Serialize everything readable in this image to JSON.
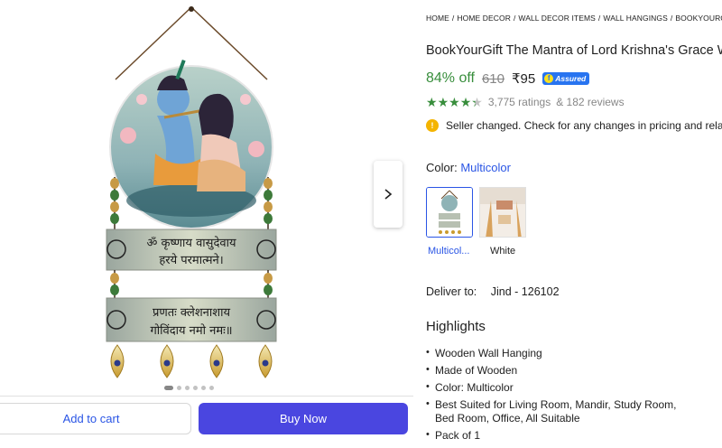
{
  "breadcrumb": [
    "HOME",
    "HOME DECOR",
    "WALL DECOR ITEMS",
    "WALL HANGINGS",
    "BOOKYOURGIF"
  ],
  "product": {
    "title": "BookYourGift The Mantra of Lord Krishna's Grace W",
    "discount": "84% off",
    "mrp": "610",
    "price": "₹95",
    "assured_label": "Assured",
    "rating_stars": 4.3,
    "ratings_text": "3,775 ratings",
    "reviews_text": "& 182 reviews"
  },
  "seller_notice": "Seller changed. Check for any changes in pricing and relate",
  "color": {
    "label": "Color:",
    "selected": "Multicolor",
    "options": [
      "Multicol...",
      "White"
    ]
  },
  "delivery": {
    "label": "Deliver to:",
    "location": "Jind - 126102"
  },
  "highlights": {
    "title": "Highlights",
    "items": [
      "Wooden Wall Hanging",
      "Made of Wooden",
      "Color: Multicolor",
      "Best Suited for Living Room, Mandir, Study Room, Bed Room, Office, All Suitable",
      "Pack of 1"
    ]
  },
  "artwork": {
    "line1": "ॐ कृष्णाय वासुदेवाय",
    "line2": "हरये परमात्मने।",
    "line3": "प्रणतः क्लेशनाशाय",
    "line4": "गोविंदाय नमो नमः॥"
  },
  "gallery": {
    "image_count": 6,
    "active_index": 0
  },
  "actions": {
    "add_to_cart": "Add to cart",
    "buy_now": "Buy Now"
  },
  "colors": {
    "accent_blue": "#2a55e5",
    "buy_button": "#4a46e0",
    "discount_green": "#388e3c",
    "star_green": "#388e3c",
    "assured_blue": "#2874f0"
  },
  "icons": [
    "chevron-right-icon",
    "info-icon",
    "star-icon",
    "assured-badge-icon"
  ]
}
